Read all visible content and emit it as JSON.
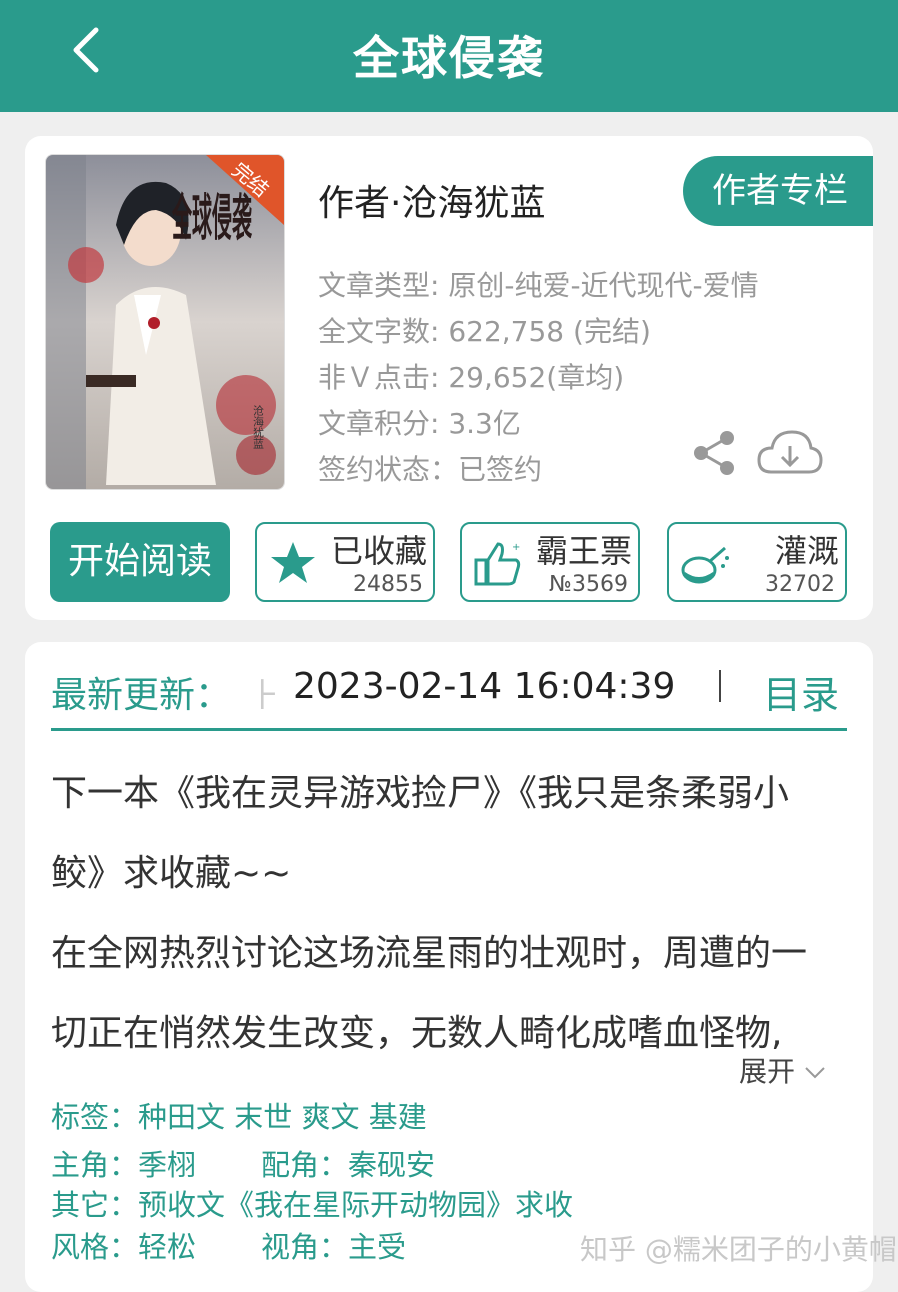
{
  "header": {
    "title": "全球侵袭"
  },
  "book": {
    "cover_title": "全球侵袭",
    "cover_badge": "完结",
    "cover_author": "沧海犹蓝",
    "author": "作者·沧海犹蓝",
    "author_column_label": "作者专栏",
    "meta": {
      "type": "文章类型: 原创-纯爱-近代现代-爱情",
      "words": "全文字数: 622,758 (完结)",
      "clicks": "非Ｖ点击: 29,652(章均)",
      "score": "文章积分: 3.3亿",
      "sign": "签约状态：已签约"
    }
  },
  "actions": {
    "read_label": "开始阅读",
    "collect": {
      "label": "已收藏",
      "count": "24855"
    },
    "vote": {
      "label": "霸王票",
      "count": "№3569"
    },
    "water": {
      "label": "灌溉",
      "count": "32702"
    }
  },
  "update": {
    "label": "最新更新：",
    "faint": "⺊",
    "date": "2023-02-14 16:04:39",
    "toc_label": "目录"
  },
  "description": {
    "lines": [
      "下一本《我在灵异游戏捡尸》《我只是条柔弱小",
      "鲛》求收藏~~",
      "在全网热烈讨论这场流星雨的壮观时，周遭的一",
      "切正在悄然发生改变，无数人畸化成嗜血怪物,"
    ],
    "expand_label": "展开"
  },
  "info": {
    "tags_key": "标签：",
    "tags": [
      "种田文",
      "末世",
      "爽文",
      "基建"
    ],
    "protagonist_key": "主角：",
    "protagonist": "季栩",
    "supporting_key": "配角：",
    "supporting": "秦砚安",
    "other_key": "其它：",
    "other": "预收文《我在星际开动物园》求收",
    "style_key": "风格：",
    "style": "轻松",
    "view_key": "视角：",
    "view": "主受"
  },
  "watermark": "知乎 @糯米团子的小黄帽",
  "colors": {
    "accent": "#2a9b8c",
    "background": "#efefef"
  },
  "icons": [
    "back-arrow-icon",
    "share-icon",
    "cloud-download-icon",
    "star-icon",
    "thumbs-up-icon",
    "watering-can-icon",
    "chevron-down-icon"
  ]
}
